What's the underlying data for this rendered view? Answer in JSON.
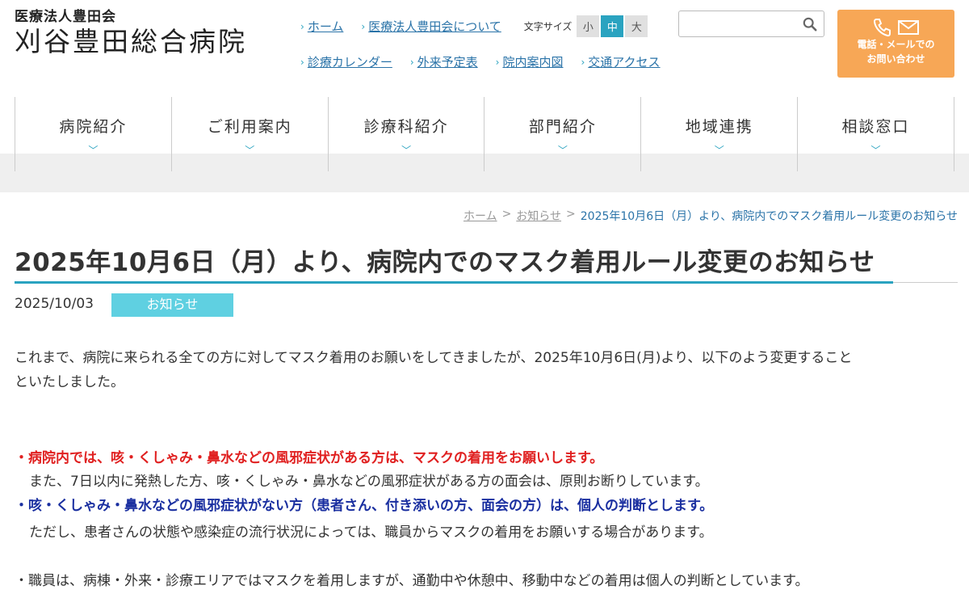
{
  "header": {
    "logo_sub": "医療法人豊田会",
    "logo_main": "刈谷豊田総合病院",
    "util_links_row1": [
      "ホーム",
      "医療法人豊田会について"
    ],
    "util_links_row2": [
      "診療カレンダー",
      "外来予定表",
      "院内案内図",
      "交通アクセス"
    ],
    "font_size_label": "文字サイズ",
    "font_sizes": [
      "小",
      "中",
      "大"
    ],
    "font_size_selected": "中",
    "search_placeholder": "",
    "contact_line1": "電話・メールでの",
    "contact_line2": "お問い合わせ"
  },
  "nav": {
    "items": [
      "病院紹介",
      "ご利用案内",
      "診療科紹介",
      "部門紹介",
      "地域連携",
      "相談窓口"
    ]
  },
  "breadcrumb": {
    "home": "ホーム",
    "news": "お知らせ",
    "current": "2025年10月6日（月）より、病院内でのマスク着用ルール変更のお知らせ"
  },
  "article": {
    "title": "2025年10月6日（月）より、病院内でのマスク着用ルール変更のお知らせ",
    "date": "2025/10/03",
    "category": "お知らせ",
    "intro_line1": "これまで、病院に来られる全ての方に対してマスク着用のお願いをしてきましたが、2025年10月6日(月)より、以下のよう変更すること",
    "intro_line2": "といたしました。",
    "item_red": "・病院内では、咳・くしゃみ・鼻水などの風邪症状がある方は、マスクの着用をお願いします。",
    "note1": "また、7日以内に発熱した方、咳・くしゃみ・鼻水などの風邪症状がある方の面会は、原則お断りしています。",
    "item_blue": "・咳・くしゃみ・鼻水などの風邪症状がない方（患者さん、付き添いの方、面会の方）は、個人の判断とします。",
    "note2": "ただし、患者さんの状態や感染症の流行状況によっては、職員からマスクの着用をお願いする場合があります。",
    "item_staff": "・職員は、病棟・外来・診療エリアではマスクを着用しますが、通勤中や休憩中、移動中などの着用は個人の判断としています。"
  },
  "colors": {
    "accent": "#2aa3c0",
    "badge": "#5fd0e1",
    "contact": "#f7a756",
    "red_text": "#e02020",
    "blue_text": "#1a2fa0"
  }
}
